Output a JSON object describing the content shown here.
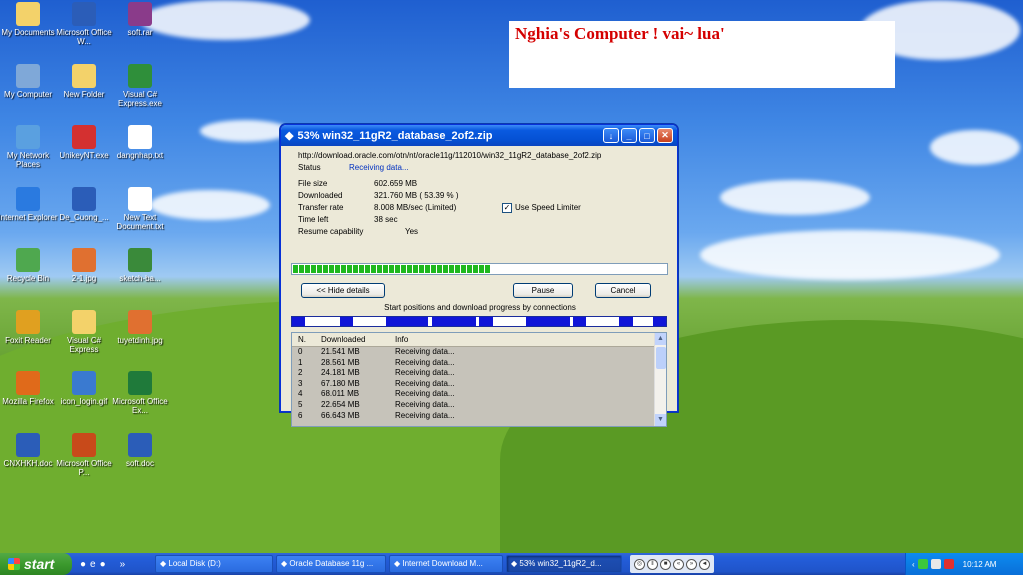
{
  "banner": {
    "text": "Nghia's Computer ! vai~ lua'"
  },
  "desktop_icons": [
    {
      "label": "My Documents",
      "icon": "folder-icon",
      "color": "#f3d26a"
    },
    {
      "label": "Microsoft Office W...",
      "icon": "word-icon",
      "color": "#2b5db8"
    },
    {
      "label": "soft.rar",
      "icon": "rar-icon",
      "color": "#8a3b8a"
    },
    {
      "label": "My Computer",
      "icon": "computer-icon",
      "color": "#7fa8d8"
    },
    {
      "label": "New Folder",
      "icon": "folder-icon",
      "color": "#f3d26a"
    },
    {
      "label": "Visual C# Express.exe",
      "icon": "csharp-icon",
      "color": "#2f8f3a"
    },
    {
      "label": "My Network Places",
      "icon": "network-icon",
      "color": "#5aa0e0"
    },
    {
      "label": "UnikeyNT.exe",
      "icon": "unikey-icon",
      "color": "#d43030"
    },
    {
      "label": "dangnhap.txt",
      "icon": "text-file-icon",
      "color": "#ffffff"
    },
    {
      "label": "Internet Explorer",
      "icon": "ie-icon",
      "color": "#2a7ae0"
    },
    {
      "label": "De_Cuong_...",
      "icon": "word-doc-icon",
      "color": "#2b5db8"
    },
    {
      "label": "New Text Document.txt",
      "icon": "text-file-icon",
      "color": "#ffffff"
    },
    {
      "label": "Recycle Bin",
      "icon": "recycle-bin-icon",
      "color": "#4fa84f"
    },
    {
      "label": "2-1.jpg",
      "icon": "image-icon",
      "color": "#e07030"
    },
    {
      "label": "sketch-ba...",
      "icon": "dollar-icon",
      "color": "#3a8a3a"
    },
    {
      "label": "Foxit Reader",
      "icon": "foxit-icon",
      "color": "#e0a020"
    },
    {
      "label": "Visual C# Express",
      "icon": "folder-icon",
      "color": "#f3d26a"
    },
    {
      "label": "tuyetdinh.jpg",
      "icon": "image-icon",
      "color": "#e07030"
    },
    {
      "label": "Mozilla Firefox",
      "icon": "firefox-icon",
      "color": "#e06a1a"
    },
    {
      "label": "icon_login.gif",
      "icon": "gif-icon",
      "color": "#3a7ad0"
    },
    {
      "label": "Microsoft Office Ex...",
      "icon": "excel-icon",
      "color": "#1f7a3a"
    },
    {
      "label": "CNXHKH.doc",
      "icon": "word-doc-icon",
      "color": "#2b5db8"
    },
    {
      "label": "Microsoft Office P...",
      "icon": "powerpoint-icon",
      "color": "#c84a1a"
    },
    {
      "label": "soft.doc",
      "icon": "word-doc-icon",
      "color": "#2b5db8"
    }
  ],
  "window": {
    "title": "53% win32_11gR2_database_2of2.zip",
    "url": "http://download.oracle.com/otn/nt/oracle11g/112010/win32_11gR2_database_2of2.zip",
    "status_label": "Status",
    "status_value": "Receiving data...",
    "file_size_label": "File size",
    "file_size_value": "602.659  MB",
    "downloaded_label": "Downloaded",
    "downloaded_value": "321.760  MB  ( 53.39 % )",
    "rate_label": "Transfer rate",
    "rate_value": "8.008  MB/sec  (Limited)",
    "time_left_label": "Time left",
    "time_left_value": "38 sec",
    "resume_label": "Resume capability",
    "resume_value": "Yes",
    "speed_limiter_label": "Use Speed Limiter",
    "speed_limiter_checked": true,
    "progress_fraction": 0.5339,
    "hide_details_label": "<< Hide details",
    "pause_label": "Pause",
    "cancel_label": "Cancel",
    "connections_caption": "Start positions and download progress by connections",
    "table_headers": [
      "N.",
      "Downloaded",
      "Info"
    ],
    "rows": [
      [
        "0",
        "21.541  MB",
        "Receiving data..."
      ],
      [
        "1",
        "28.561  MB",
        "Receiving data..."
      ],
      [
        "2",
        "24.181  MB",
        "Receiving data..."
      ],
      [
        "3",
        "67.180  MB",
        "Receiving data..."
      ],
      [
        "4",
        "68.011  MB",
        "Receiving data..."
      ],
      [
        "5",
        "22.654  MB",
        "Receiving data..."
      ],
      [
        "6",
        "66.643  MB",
        "Receiving data..."
      ]
    ]
  },
  "taskbar": {
    "start_label": "start",
    "tasks": [
      {
        "label": "Local Disk (D:)",
        "icon": "drive-icon"
      },
      {
        "label": "Oracle Database 11g ...",
        "icon": "ie-icon"
      },
      {
        "label": "Internet Download M...",
        "icon": "idm-icon"
      },
      {
        "label": "53% win32_11gR2_d...",
        "icon": "idm-icon"
      }
    ],
    "clock": "10:12 AM"
  }
}
